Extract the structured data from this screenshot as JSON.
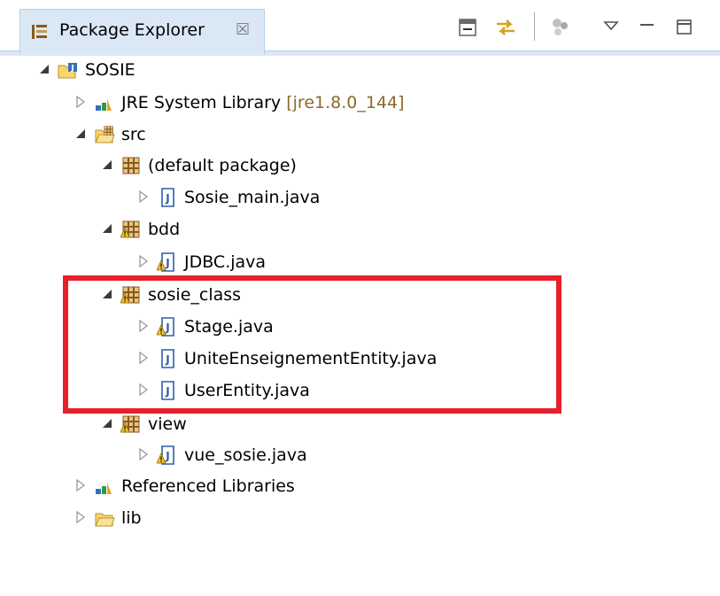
{
  "view": {
    "title": "Package Explorer",
    "close_symbol": "☒",
    "toolbar": [
      {
        "name": "collapse-all",
        "icon": "collapse-all-icon"
      },
      {
        "name": "link-with-editor",
        "icon": "link-editor-icon"
      },
      {
        "name": "focus-task",
        "icon": "focus-task-icon"
      },
      {
        "name": "view-menu",
        "icon": "chevron-down-icon"
      },
      {
        "name": "minimize",
        "icon": "minimize-icon"
      },
      {
        "name": "maximize",
        "icon": "maximize-icon"
      }
    ]
  },
  "tree": {
    "project": "SOSIE",
    "jre": {
      "label": "JRE System Library",
      "qualifier": "[jre1.8.0_144]"
    },
    "src": "src",
    "packages": {
      "default": {
        "label": "(default package)",
        "files": [
          "Sosie_main.java"
        ]
      },
      "bdd": {
        "label": "bdd",
        "files": [
          "JDBC.java"
        ]
      },
      "sosie_class": {
        "label": "sosie_class",
        "files": [
          "Stage.java",
          "UniteEnseignementEntity.java",
          "UserEntity.java"
        ]
      },
      "view": {
        "label": "view",
        "files": [
          "vue_sosie.java"
        ]
      }
    },
    "referenced_libraries": "Referenced Libraries",
    "lib": "lib"
  },
  "highlight_color": "#e8202a",
  "colors": {
    "tab_background": "#dae8f6",
    "qualifier": "#8c6a2a",
    "package_icon": "#8a5a1c",
    "warning": "#f2c230",
    "java_file": "#2f5fa8"
  }
}
